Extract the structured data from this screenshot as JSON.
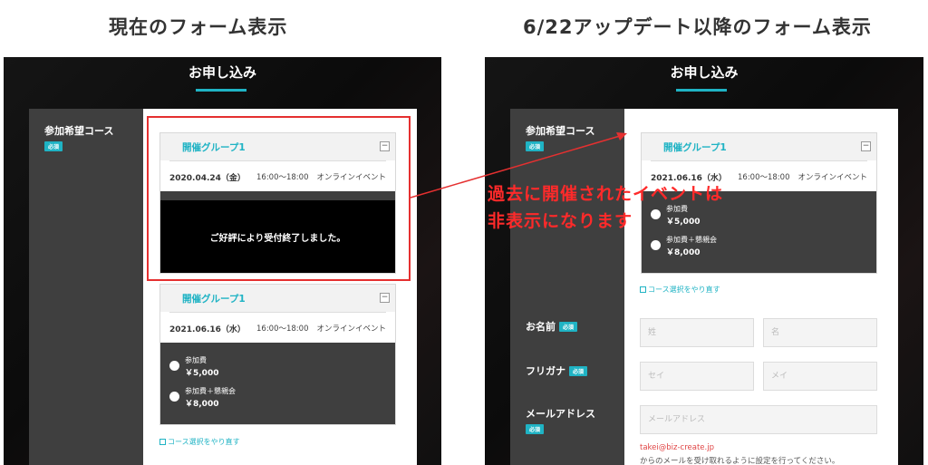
{
  "headings": {
    "current": "現在のフォーム表示",
    "updated": "6/22アップデート以降のフォーム表示"
  },
  "form": {
    "title": "お申し込み",
    "course_label": "参加希望コース",
    "required": "必須",
    "group_title": "開催グループ1",
    "toggle_symbol": "−",
    "ended_event": {
      "date": "2020.04.24（金）",
      "time": "16:00〜18:00",
      "type": "オンラインイベント",
      "overlay": "ご好評により受付終了しました。"
    },
    "upcoming_event": {
      "date": "2021.06.16（水）",
      "time": "16:00〜18:00",
      "type": "オンラインイベント"
    },
    "options": [
      {
        "name": "参加費",
        "price": "￥5,000"
      },
      {
        "name": "参加費＋懇親会",
        "price": "￥8,000"
      }
    ],
    "reselect": "コース選択をやり直す",
    "name_label": "お名前",
    "kana_label": "フリガナ",
    "email_label": "メールアドレス",
    "placeholders": {
      "last_name": "姓",
      "first_name": "名",
      "last_kana": "セイ",
      "first_kana": "メイ",
      "email": "メールアドレス"
    },
    "email_note_address": "takei@biz-create.jp",
    "email_note_text": "からのメールを受け取れるように設定を行ってください。"
  },
  "annotation": {
    "line1": "過去に開催されたイベントは",
    "line2": "非表示になります",
    "color": "#ff2a2a"
  },
  "colors": {
    "accent": "#1fb3c4",
    "sidebar": "#3f3f3f",
    "highlight": "#e53030"
  }
}
